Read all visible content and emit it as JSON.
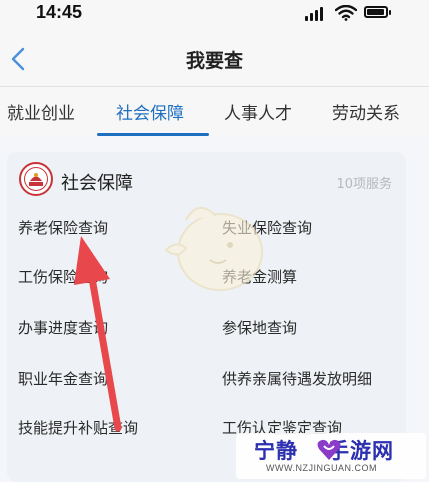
{
  "status_bar": {
    "time": "14:45"
  },
  "nav": {
    "title": "我要查"
  },
  "tabs": [
    {
      "label": "就业创业"
    },
    {
      "label": "社会保障",
      "active": true
    },
    {
      "label": "人事人才"
    },
    {
      "label": "劳动关系"
    }
  ],
  "card": {
    "title": "社会保障",
    "count": "10项服务",
    "items": [
      {
        "label": "养老保险查询"
      },
      {
        "label": "失业保险查询"
      },
      {
        "label": "工伤保险查询"
      },
      {
        "label": "养老金测算"
      },
      {
        "label": "办事进度查询"
      },
      {
        "label": "参保地查询"
      },
      {
        "label": "职业年金查询"
      },
      {
        "label": "供养亲属待遇发放明细"
      },
      {
        "label": "技能提升补贴查询"
      },
      {
        "label": "工伤认定鉴定查询"
      }
    ]
  },
  "watermark": {
    "name_left": "宁静",
    "name_right": "手游网",
    "url": "WWW.NZJINGUAN.COM"
  },
  "colors": {
    "accent": "#1e6fc0",
    "arrow": "#e8474c",
    "background": "#f4f6f9"
  }
}
